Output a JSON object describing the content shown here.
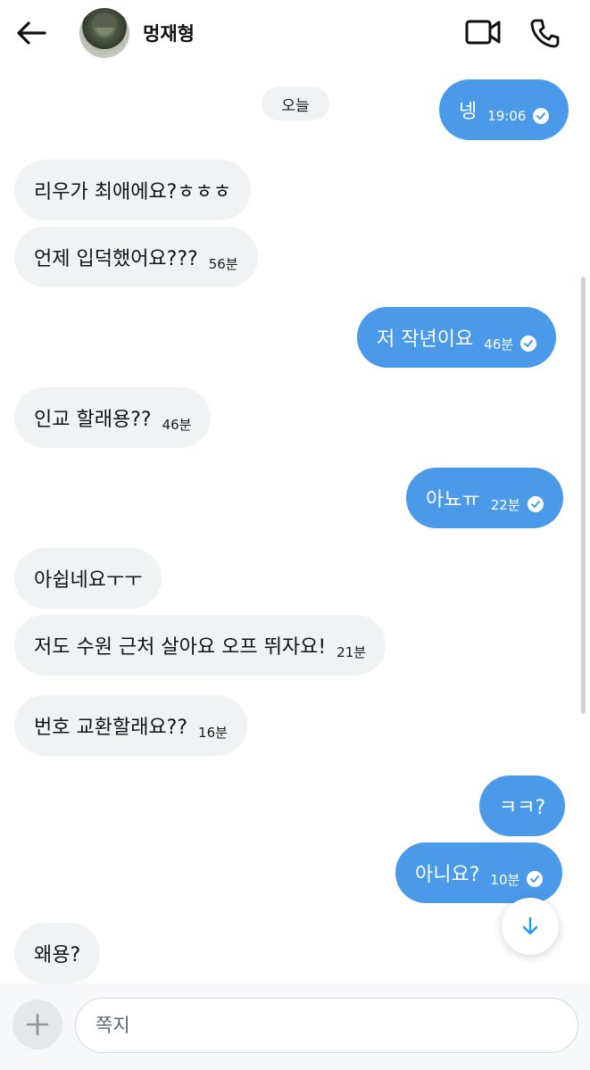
{
  "header": {
    "contact_name": "멍재형"
  },
  "date_chip": "오늘",
  "messages": [
    {
      "dir": "out",
      "text": "넹",
      "time": "19:06",
      "read": true
    },
    {
      "dir": "in",
      "text": "리우가 최애에요?ㅎㅎㅎ",
      "time": ""
    },
    {
      "dir": "in",
      "text": "언제 입덕했어요???",
      "time": "56분"
    },
    {
      "dir": "out",
      "text": "저 작년이요",
      "time": "46분",
      "read": true
    },
    {
      "dir": "in",
      "text": "인교 할래용??",
      "time": "46분"
    },
    {
      "dir": "out",
      "text": "아뇨ㅠ",
      "time": "22분",
      "read": true
    },
    {
      "dir": "in",
      "text": "아쉽네요ㅜㅜ",
      "time": ""
    },
    {
      "dir": "in",
      "text": "저도 수원 근처 살아요 오프 뛰자요!",
      "time": "21분"
    },
    {
      "dir": "in",
      "text": "번호 교환할래요??",
      "time": "16분"
    },
    {
      "dir": "out",
      "text": "ㅋㅋ?",
      "time": ""
    },
    {
      "dir": "out",
      "text": "아니요?",
      "time": "10분",
      "read": true
    },
    {
      "dir": "in",
      "text": "왜용?",
      "time": ""
    }
  ],
  "composer": {
    "placeholder": "쪽지"
  },
  "icons": {
    "back": "arrow-left-icon",
    "video": "video-camera-icon",
    "call": "phone-icon",
    "add": "plus-icon",
    "scroll_down": "arrow-down-icon",
    "read": "check-circle-icon"
  },
  "colors": {
    "outgoing_bubble": "#4a9ae9",
    "incoming_bubble": "#eff3f4",
    "accent": "#1d9bf0"
  }
}
